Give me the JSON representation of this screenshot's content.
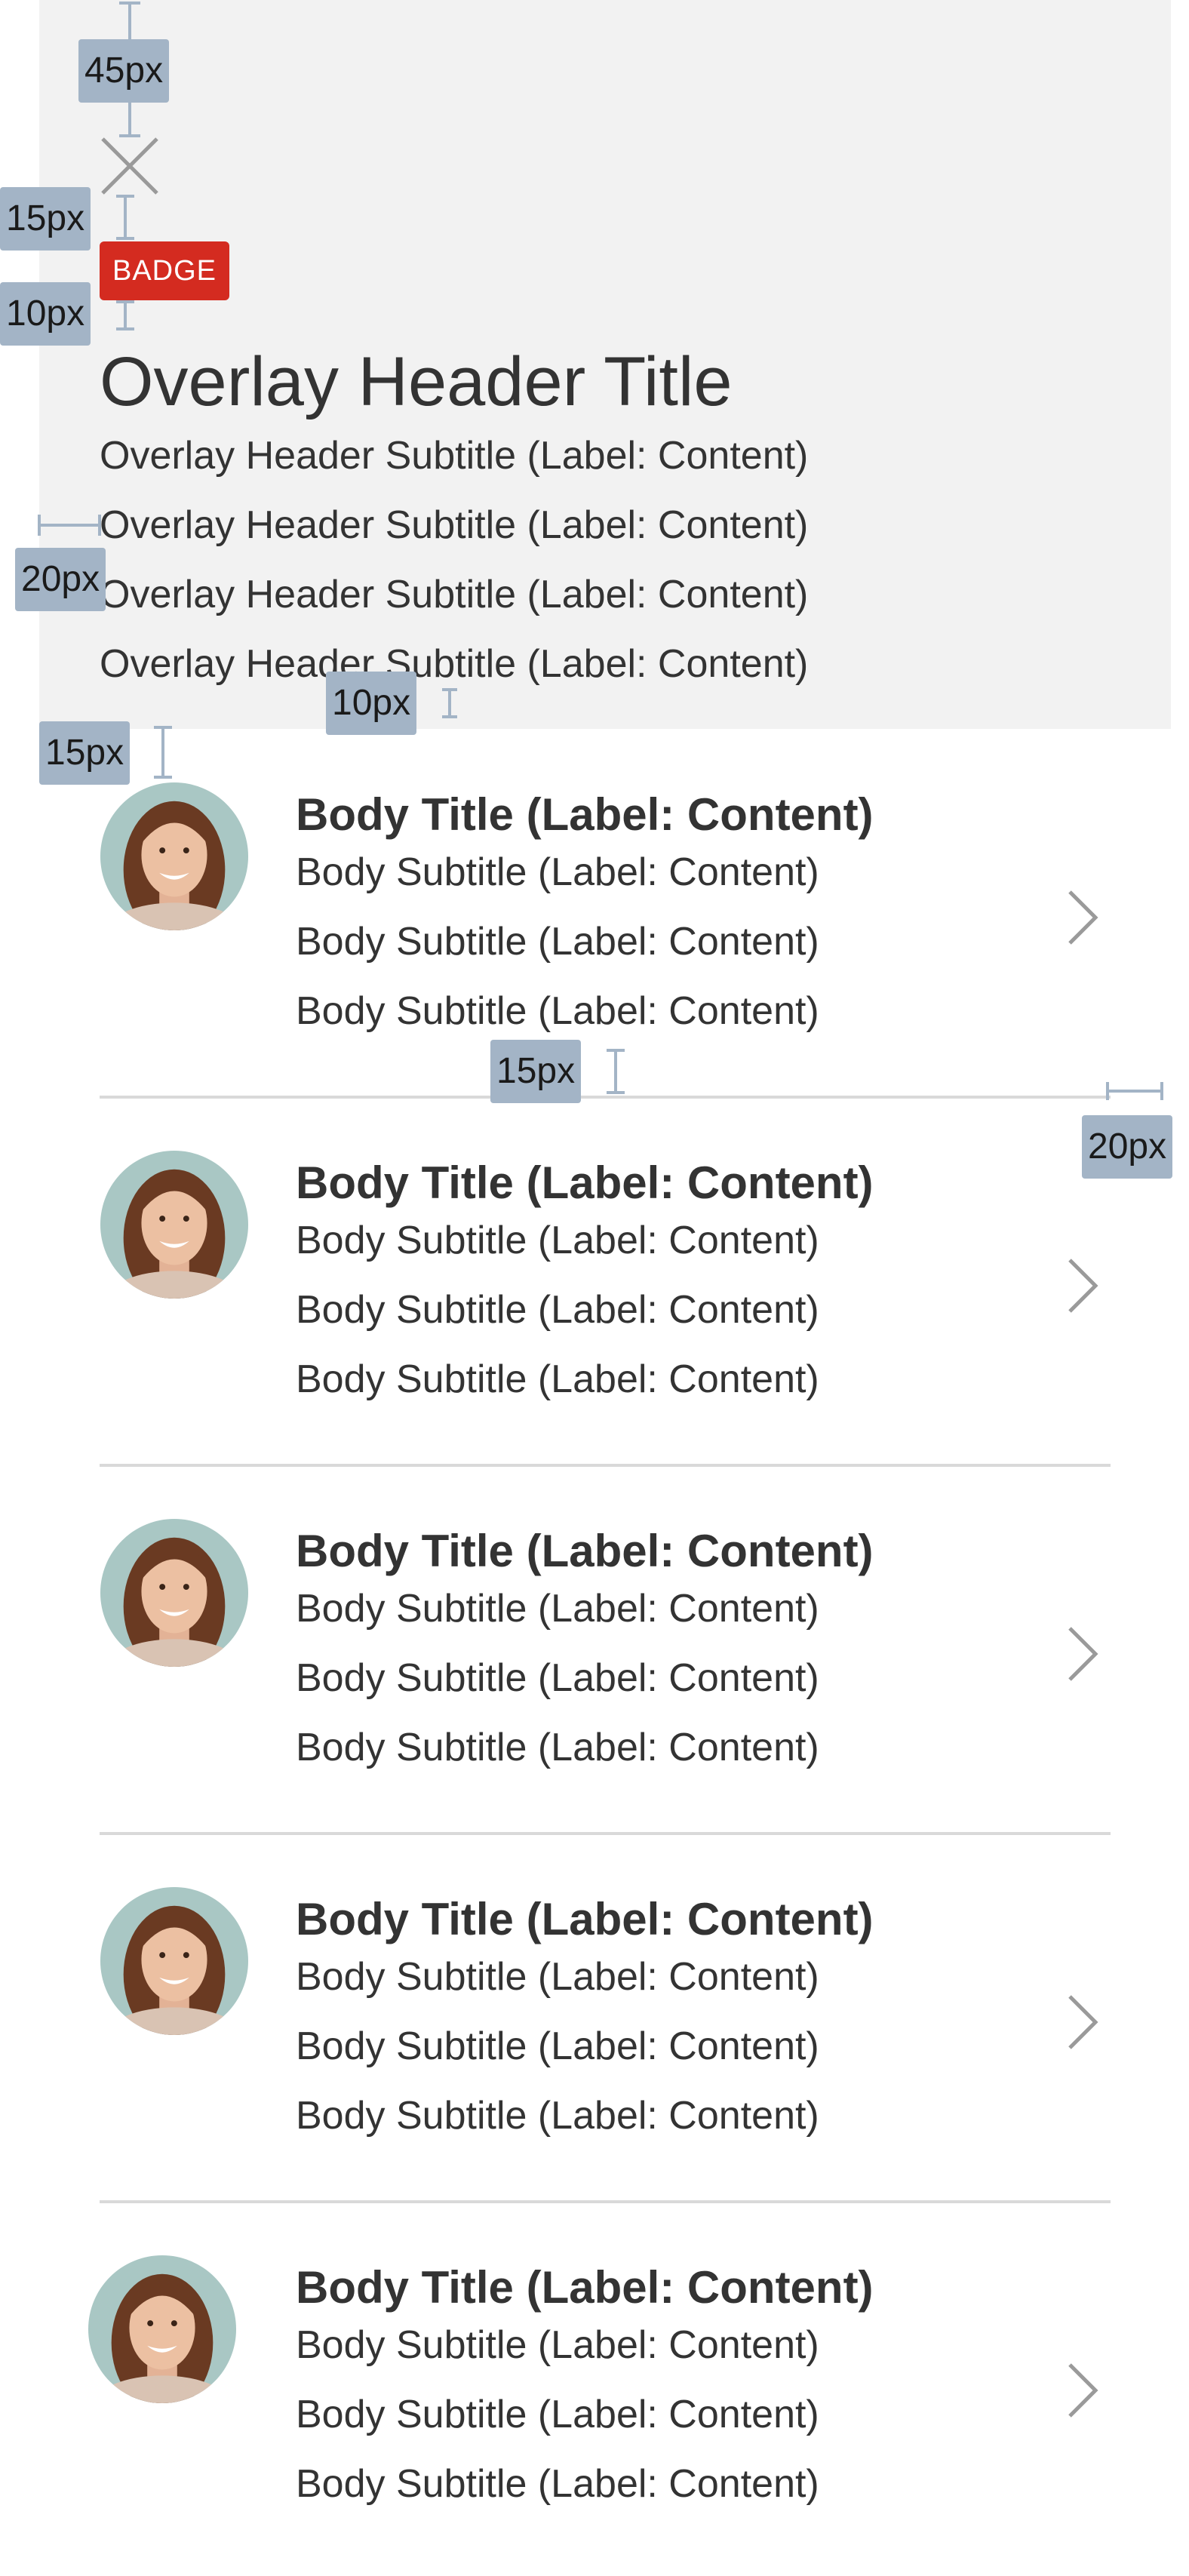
{
  "header": {
    "badge": "BADGE",
    "title": "Overlay Header Title",
    "subtitles": [
      "Overlay Header Subtitle (Label: Content)",
      "Overlay Header Subtitle (Label: Content)",
      "Overlay Header Subtitle (Label: Content)",
      "Overlay Header Subtitle (Label: Content)"
    ]
  },
  "list": {
    "items": [
      {
        "title": "Body Title (Label: Content)",
        "subtitles": [
          "Body Subtitle (Label: Content)",
          "Body Subtitle (Label: Content)",
          "Body Subtitle (Label: Content)"
        ]
      },
      {
        "title": "Body Title (Label: Content)",
        "subtitles": [
          "Body Subtitle (Label: Content)",
          "Body Subtitle (Label: Content)",
          "Body Subtitle (Label: Content)"
        ]
      },
      {
        "title": "Body Title (Label: Content)",
        "subtitles": [
          "Body Subtitle (Label: Content)",
          "Body Subtitle (Label: Content)",
          "Body Subtitle (Label: Content)"
        ]
      },
      {
        "title": "Body Title (Label: Content)",
        "subtitles": [
          "Body Subtitle (Label: Content)",
          "Body Subtitle (Label: Content)",
          "Body Subtitle (Label: Content)"
        ]
      },
      {
        "title": "Body Title (Label: Content)",
        "subtitles": [
          "Body Subtitle (Label: Content)",
          "Body Subtitle (Label: Content)",
          "Body Subtitle (Label: Content)"
        ]
      }
    ]
  },
  "annotations": [
    "45px",
    "15px",
    "10px",
    "20px",
    "10px",
    "15px",
    "15px",
    "20px"
  ],
  "colors": {
    "header_background": "#f2f2f2",
    "badge": "#d42b20",
    "divider": "#d9d9d9",
    "annotation": "#a3b4c6"
  },
  "icons": {
    "close": "close-icon",
    "chevron": "chevron-right-icon",
    "avatar": "avatar"
  }
}
